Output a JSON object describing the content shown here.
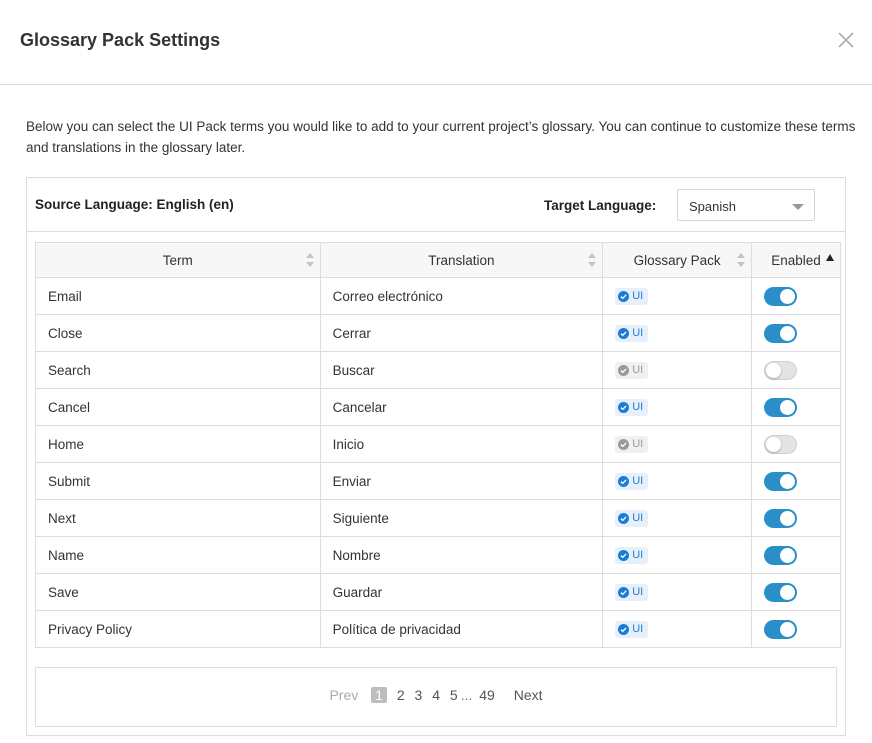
{
  "modal": {
    "title": "Glossary Pack Settings",
    "intro": "Below you can select the UI Pack terms you would like to add to your current project’s glossary. You can continue to customize these terms and translations in the glossary later."
  },
  "languages": {
    "source_label": "Source Language: English (en)",
    "target_label": "Target Language:",
    "target_value": "Spanish"
  },
  "table": {
    "headers": {
      "term": "Term",
      "translation": "Translation",
      "pack": "Glossary Pack",
      "enabled": "Enabled"
    },
    "rows": [
      {
        "term": "Email",
        "translation": "Correo electrónico",
        "pack": "UI",
        "enabled": true
      },
      {
        "term": "Close",
        "translation": "Cerrar",
        "pack": "UI",
        "enabled": true
      },
      {
        "term": "Search",
        "translation": "Buscar",
        "pack": "UI",
        "enabled": false
      },
      {
        "term": "Cancel",
        "translation": "Cancelar",
        "pack": "UI",
        "enabled": true
      },
      {
        "term": "Home",
        "translation": "Inicio",
        "pack": "UI",
        "enabled": false
      },
      {
        "term": "Submit",
        "translation": "Enviar",
        "pack": "UI",
        "enabled": true
      },
      {
        "term": "Next",
        "translation": "Siguiente",
        "pack": "UI",
        "enabled": true
      },
      {
        "term": "Name",
        "translation": "Nombre",
        "pack": "UI",
        "enabled": true
      },
      {
        "term": "Save",
        "translation": "Guardar",
        "pack": "UI",
        "enabled": true
      },
      {
        "term": "Privacy Policy",
        "translation": "Política de privacidad",
        "pack": "UI",
        "enabled": true
      }
    ]
  },
  "pagination": {
    "prev": "Prev",
    "pages": [
      "1",
      "2",
      "3",
      "4",
      "5"
    ],
    "current": "1",
    "ellipsis": "...",
    "last": "49",
    "next": "Next"
  },
  "colors": {
    "accent": "#2a8fc9",
    "badge_on": "#1c7cd5",
    "badge_off": "#9a9a9a"
  },
  "icons": {
    "close": "close-icon",
    "sort": "sort-icon",
    "sort_asc": "sort-asc-icon",
    "check": "check-circle-icon",
    "dropdown": "chevron-down-icon"
  }
}
